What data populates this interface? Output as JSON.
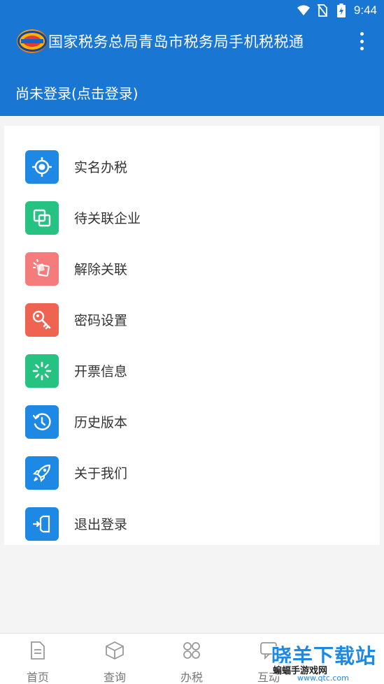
{
  "status_bar": {
    "time": "9:44",
    "icons": [
      "wifi-icon",
      "no-sim-icon",
      "battery-charging-icon"
    ]
  },
  "app_bar": {
    "title": "国家税务总局青岛市税务局手机税税通",
    "logo_icon": "app-logo-icon",
    "menu_icon": "more-vert-icon"
  },
  "login": {
    "text": "尚未登录(点击登录)"
  },
  "menu": {
    "items": [
      {
        "label": "实名办税",
        "icon": "target-icon",
        "color": "#1e88e5"
      },
      {
        "label": "待关联企业",
        "icon": "link-squares-icon",
        "color": "#26c281"
      },
      {
        "label": "解除关联",
        "icon": "unlink-icon",
        "color": "#f47c7c"
      },
      {
        "label": "密码设置",
        "icon": "key-icon",
        "color": "#ef6351"
      },
      {
        "label": "开票信息",
        "icon": "loading-icon",
        "color": "#26c281"
      },
      {
        "label": "历史版本",
        "icon": "history-icon",
        "color": "#1e88e5"
      },
      {
        "label": "关于我们",
        "icon": "rocket-icon",
        "color": "#1e88e5"
      },
      {
        "label": "退出登录",
        "icon": "logout-icon",
        "color": "#1e88e5"
      }
    ]
  },
  "bottom_nav": {
    "items": [
      {
        "label": "首页",
        "icon": "document-icon"
      },
      {
        "label": "查询",
        "icon": "box-icon"
      },
      {
        "label": "办税",
        "icon": "grid-icon"
      },
      {
        "label": "互动",
        "icon": "chat-icon"
      }
    ]
  },
  "watermark": {
    "main": "晓羊下载站",
    "sub": "蝙蝠手游戏网",
    "site": "www.qtc.com"
  },
  "colors": {
    "primary": "#1976d2",
    "background": "#f4f4f4"
  }
}
